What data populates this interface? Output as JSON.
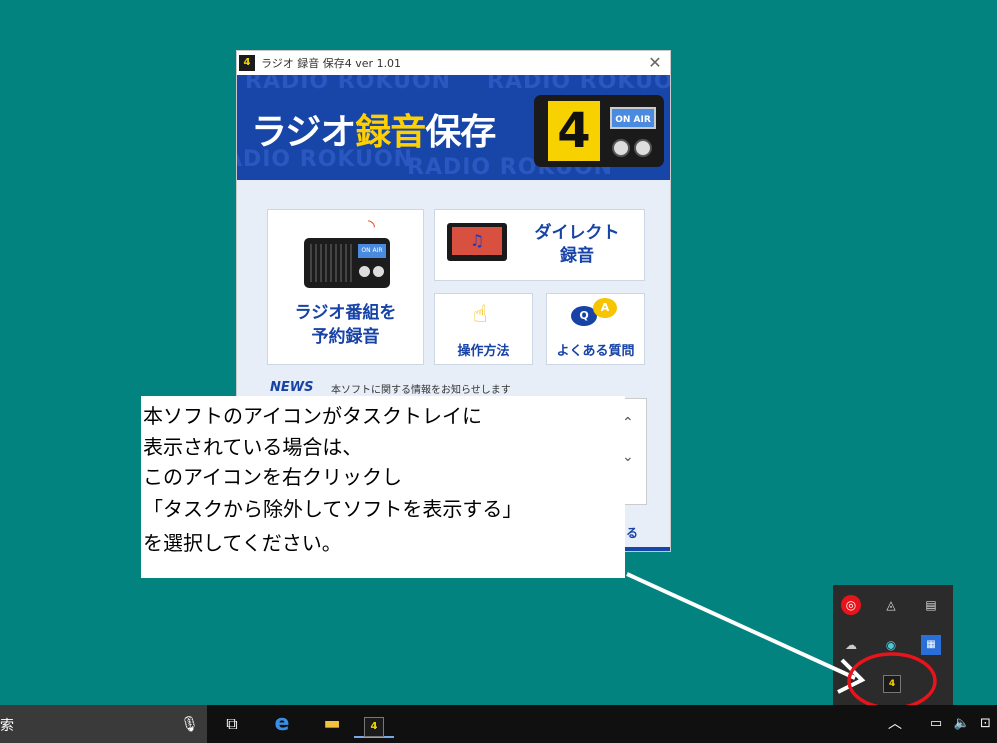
{
  "window": {
    "title": "ラジオ 録音 保存4 ver 1.01",
    "app_badge": "4",
    "close_glyph": "✕"
  },
  "banner": {
    "title_part1": "ラジオ",
    "title_part2": "録音",
    "title_part3": "保存",
    "watermark": "RADIO ROKUON",
    "number": "4",
    "onair": "ON AIR"
  },
  "cards": {
    "reserve_line1": "ラジオ番組を",
    "reserve_line2": "予約録音",
    "direct_line1": "ダイレクト",
    "direct_line2": "録音",
    "howto": "操作方法",
    "faq": "よくある質問",
    "radio_onair": "ON AIR",
    "faq_q": "Q",
    "faq_a": "A"
  },
  "news": {
    "label": "NEWS",
    "description": "本ソフトに関する情報をお知らせします",
    "partial_text": "る"
  },
  "callout": {
    "line1": "本ソフトのアイコンがタスクトレイに",
    "line2": "表示されている場合は、",
    "line3": "このアイコンを右クリックし",
    "line4": "「タスクから除外してソフトを表示する」",
    "line5": "を選択してください。"
  },
  "taskbar": {
    "search_partial": "索",
    "app_badge": "4"
  },
  "colors": {
    "desktop": "#03837f",
    "brand_blue": "#1746a8",
    "accent_yellow": "#ffcf00",
    "highlight_red": "#e8141c"
  }
}
